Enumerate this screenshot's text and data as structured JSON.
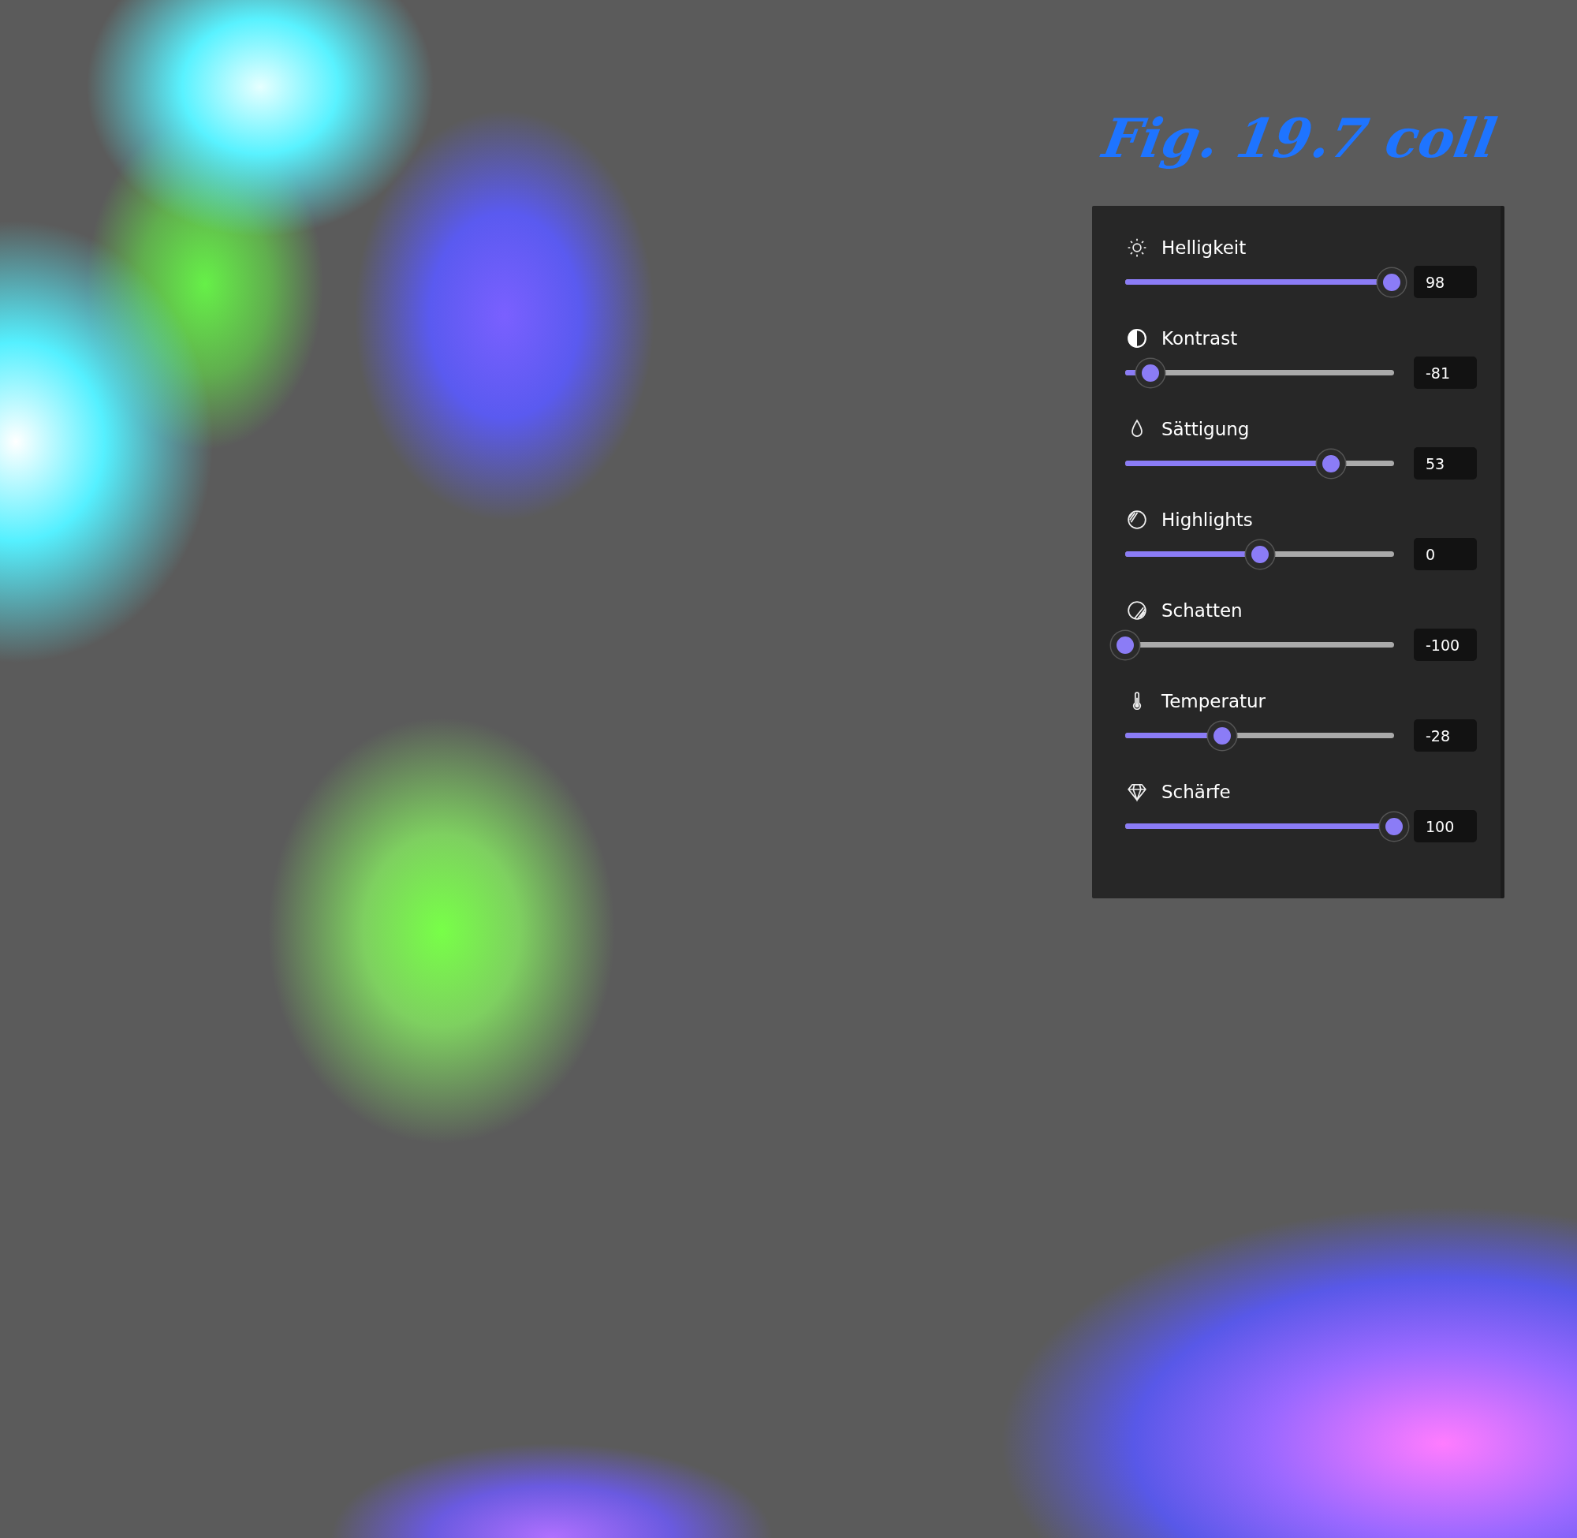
{
  "annotation": "Fig. 19.7 coll",
  "adjustments": [
    {
      "kind": "brightness",
      "label": "Helligkeit",
      "level": 0.99,
      "value": "98"
    },
    {
      "kind": "contrast",
      "label": "Kontrast",
      "level": 0.095,
      "value": "-81"
    },
    {
      "kind": "saturation",
      "label": "Sättigung",
      "level": 0.765,
      "value": "53"
    },
    {
      "kind": "highlights",
      "label": "Highlights",
      "level": 0.5,
      "value": "0"
    },
    {
      "kind": "shadows",
      "label": "Schatten",
      "level": 0,
      "value": "-100"
    },
    {
      "kind": "temperature",
      "label": "Temperatur",
      "level": 0.36,
      "value": "-28"
    },
    {
      "kind": "sharpness",
      "label": "Schärfe",
      "level": 1,
      "value": "100"
    }
  ]
}
